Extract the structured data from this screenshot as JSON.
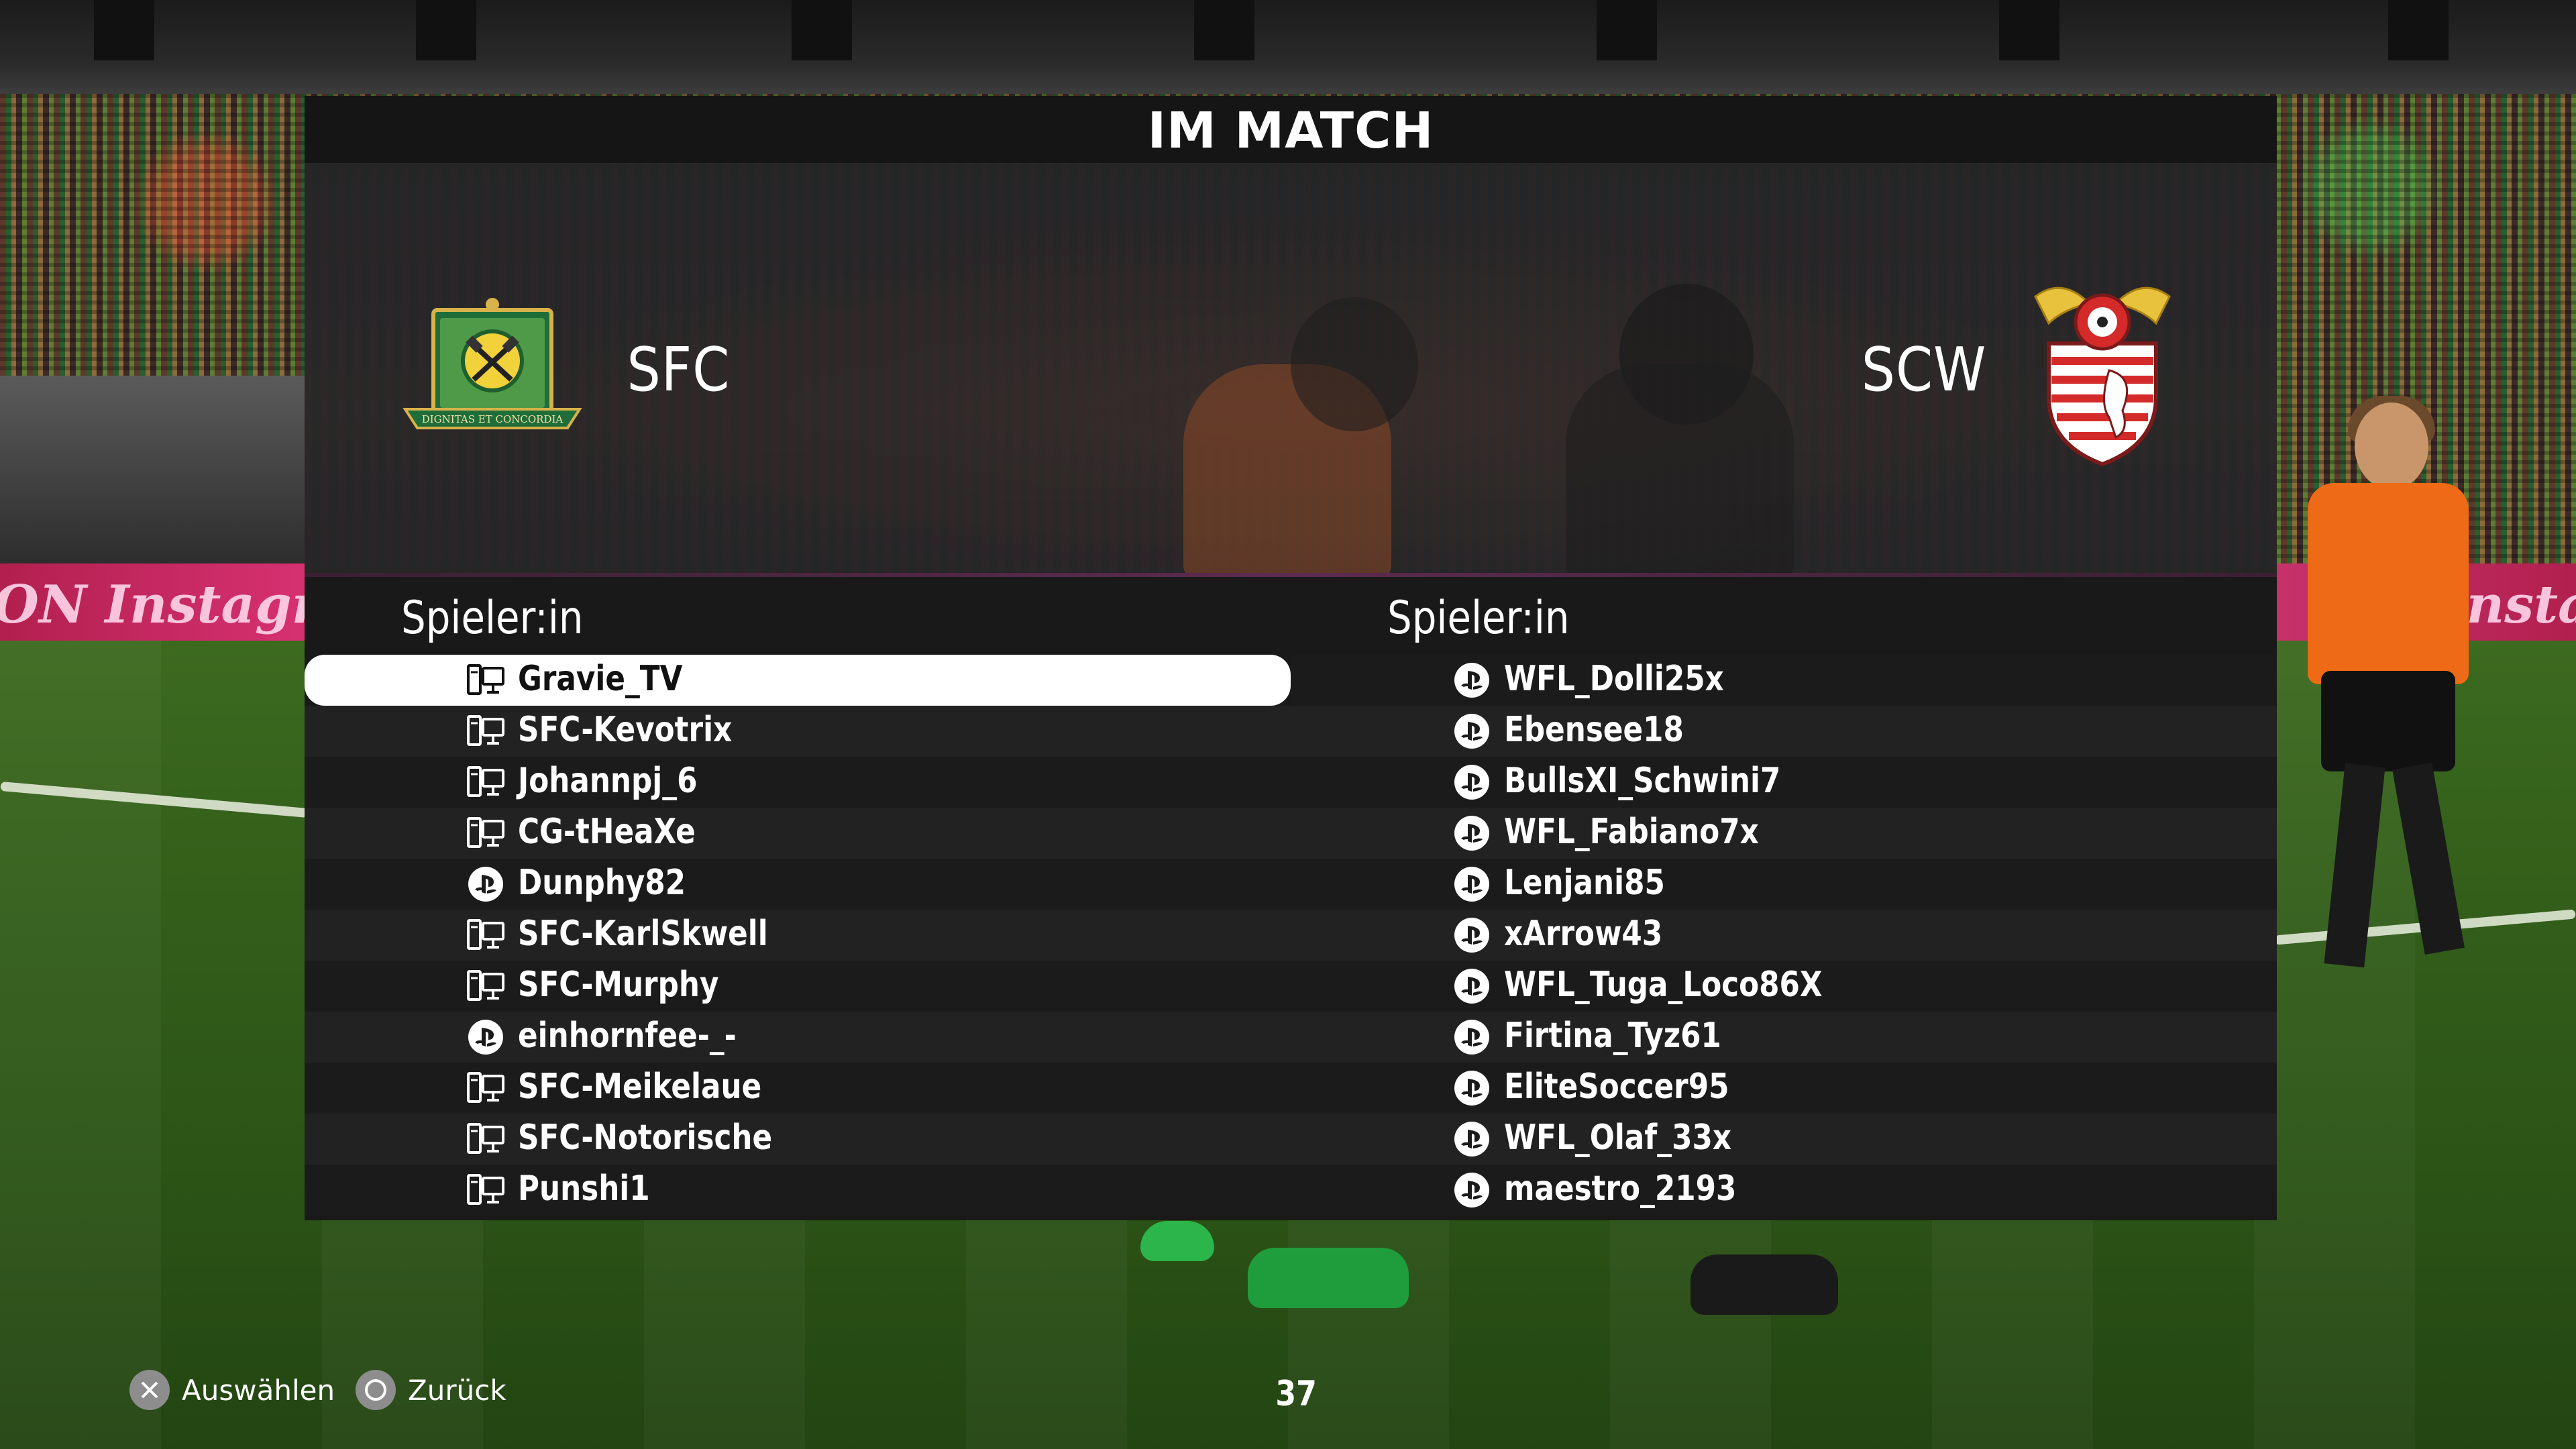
{
  "screen": {
    "title": "IM MATCH"
  },
  "teams": {
    "home": {
      "name": "SFC",
      "crest_text": "DIGNITAS ET CONCORDIA"
    },
    "away": {
      "name": "SCW"
    }
  },
  "home_list": {
    "header": "Spieler:in",
    "players": [
      {
        "name": "Gravie_TV",
        "platform": "pc-icon",
        "selected": true
      },
      {
        "name": "SFC-Kevotrix",
        "platform": "pc-icon"
      },
      {
        "name": "Johannpj_6",
        "platform": "pc-icon"
      },
      {
        "name": "CG-tHeaXe",
        "platform": "pc-icon"
      },
      {
        "name": "Dunphy82",
        "platform": "playstation-icon"
      },
      {
        "name": "SFC-KarlSkwell",
        "platform": "pc-icon"
      },
      {
        "name": "SFC-Murphy",
        "platform": "pc-icon"
      },
      {
        "name": "einhornfee-_-",
        "platform": "playstation-icon"
      },
      {
        "name": "SFC-Meikelaue",
        "platform": "pc-icon"
      },
      {
        "name": "SFC-Notorische",
        "platform": "pc-icon"
      },
      {
        "name": "Punshi1",
        "platform": "pc-icon"
      }
    ]
  },
  "away_list": {
    "header": "Spieler:in",
    "players": [
      {
        "name": "WFL_Dolli25x",
        "platform": "playstation-icon"
      },
      {
        "name": "Ebensee18",
        "platform": "playstation-icon"
      },
      {
        "name": "BullsXI_Schwini7",
        "platform": "playstation-icon"
      },
      {
        "name": "WFL_Fabiano7x",
        "platform": "playstation-icon"
      },
      {
        "name": "Lenjani85",
        "platform": "playstation-icon"
      },
      {
        "name": "xArrow43",
        "platform": "playstation-icon"
      },
      {
        "name": "WFL_Tuga_Loco86X",
        "platform": "playstation-icon"
      },
      {
        "name": "Firtina_Tyz61",
        "platform": "playstation-icon"
      },
      {
        "name": "EliteSoccer95",
        "platform": "playstation-icon"
      },
      {
        "name": "WFL_Olaf_33x",
        "platform": "playstation-icon"
      },
      {
        "name": "maestro_2193",
        "platform": "playstation-icon"
      }
    ]
  },
  "footer": {
    "select_label": "Auswählen",
    "select_icon": "cross-button-icon",
    "back_label": "Zurück",
    "back_icon": "circle-button-icon",
    "countdown": "37"
  },
  "background": {
    "banner_text_left": "ON Instagram",
    "banner_text_right": "Instag"
  },
  "colors": {
    "panel_dark": "#191919",
    "selected_row": "#ffffff",
    "banner_pink": "#e0357a",
    "referee_vest": "#ee6a16"
  }
}
